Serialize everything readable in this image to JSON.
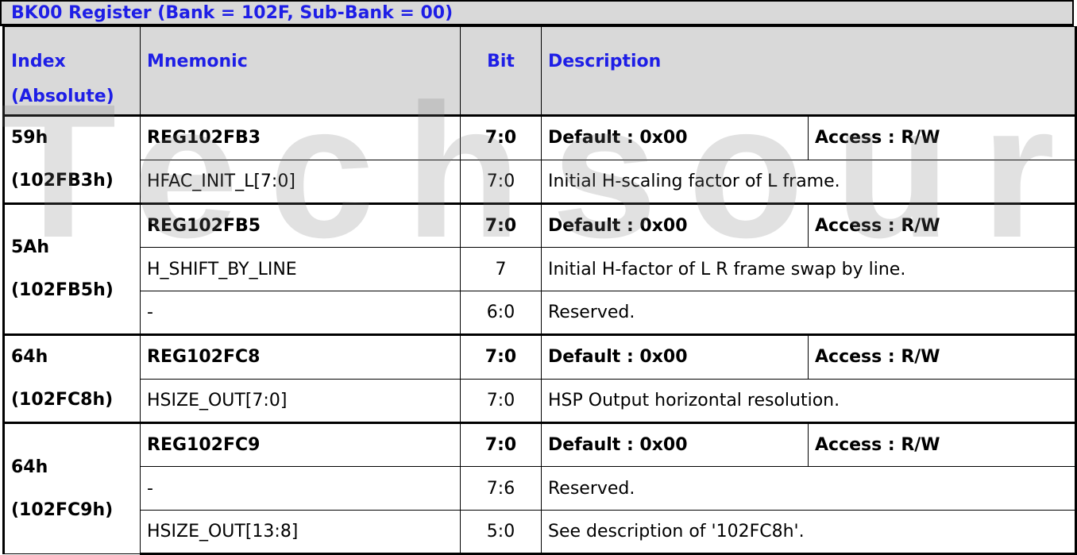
{
  "title": "BK00 Register (Bank = 102F, Sub-Bank = 00)",
  "watermark": "Techsource",
  "headers": {
    "index": "Index",
    "index_sub": "(Absolute)",
    "mnemonic": "Mnemonic",
    "bit": "Bit",
    "description": "Description"
  },
  "groups": [
    {
      "index": "59h",
      "absolute": "(102FB3h)",
      "rows": [
        {
          "mnemonic": "REG102FB3",
          "bit": "7:0",
          "default": "Default : 0x00",
          "access": "Access : R/W"
        },
        {
          "mnemonic": "HFAC_INIT_L[7:0]",
          "bit": "7:0",
          "description": "Initial H-scaling factor of L frame."
        }
      ]
    },
    {
      "index": "5Ah",
      "absolute": "(102FB5h)",
      "rows": [
        {
          "mnemonic": "REG102FB5",
          "bit": "7:0",
          "default": "Default : 0x00",
          "access": "Access : R/W"
        },
        {
          "mnemonic": "H_SHIFT_BY_LINE",
          "bit": "7",
          "description": "Initial H-factor of L R frame swap by line."
        },
        {
          "mnemonic": "-",
          "bit": "6:0",
          "description": "Reserved."
        }
      ]
    },
    {
      "index": "64h",
      "absolute": "(102FC8h)",
      "rows": [
        {
          "mnemonic": "REG102FC8",
          "bit": "7:0",
          "default": "Default : 0x00",
          "access": "Access : R/W"
        },
        {
          "mnemonic": "HSIZE_OUT[7:0]",
          "bit": "7:0",
          "description": "HSP Output horizontal resolution."
        }
      ]
    },
    {
      "index": "64h",
      "absolute": "(102FC9h)",
      "rows": [
        {
          "mnemonic": "REG102FC9",
          "bit": "7:0",
          "default": "Default : 0x00",
          "access": "Access : R/W"
        },
        {
          "mnemonic": "-",
          "bit": "7:6",
          "description": "Reserved."
        },
        {
          "mnemonic": "HSIZE_OUT[13:8]",
          "bit": "5:0",
          "description": "See description of '102FC8h'."
        }
      ]
    }
  ]
}
